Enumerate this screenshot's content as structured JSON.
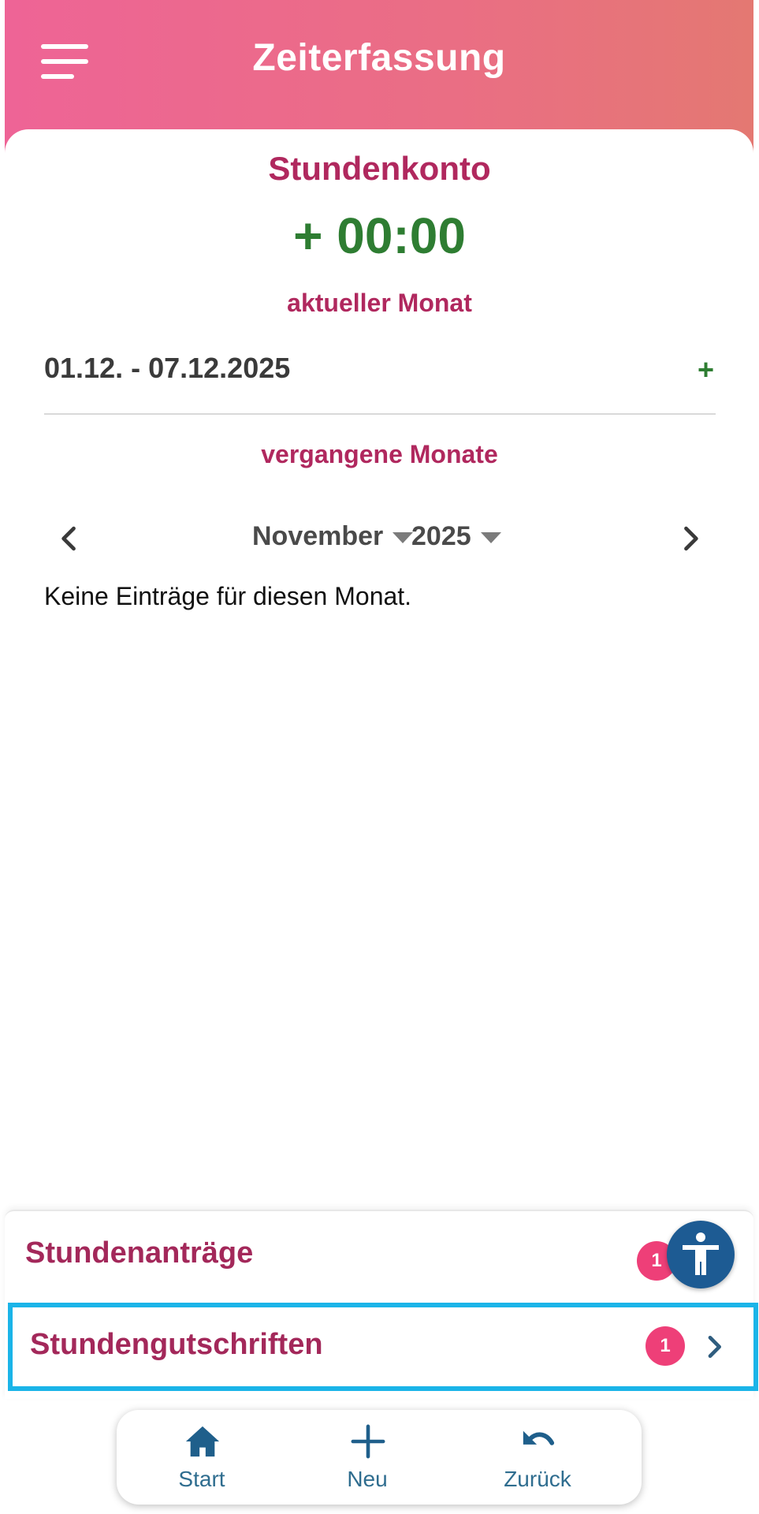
{
  "header": {
    "title": "Zeiterfassung",
    "menu_icon": "hamburger-menu-icon"
  },
  "stundenkonto": {
    "title": "Stundenkonto",
    "value": "+ 00:00",
    "current_month_title": "aktueller Monat",
    "week_range": "01.12. - 07.12.2025",
    "add_symbol": "+"
  },
  "past_months": {
    "title": "vergangene Monate",
    "month": "November",
    "year": "2025",
    "empty_text": "Keine Einträge für diesen Monat."
  },
  "panel": {
    "rows": [
      {
        "label": "Stundenanträge",
        "badge": "1"
      },
      {
        "label": "Stundengutschriften",
        "badge": "1"
      }
    ]
  },
  "tabbar": {
    "tabs": [
      {
        "label": "Start",
        "icon": "home-icon"
      },
      {
        "label": "Neu",
        "icon": "plus-icon"
      },
      {
        "label": "Zurück",
        "icon": "undo-icon"
      }
    ]
  },
  "colors": {
    "header_gradient_start": "#ee6496",
    "header_gradient_end": "#e47872",
    "accent": "#b0285e",
    "positive": "#2e7d32",
    "badge": "#ee3f78",
    "highlight_border": "#1ab4e8",
    "tab_color": "#2f6d8f",
    "a11y_button": "#1d5b93"
  }
}
